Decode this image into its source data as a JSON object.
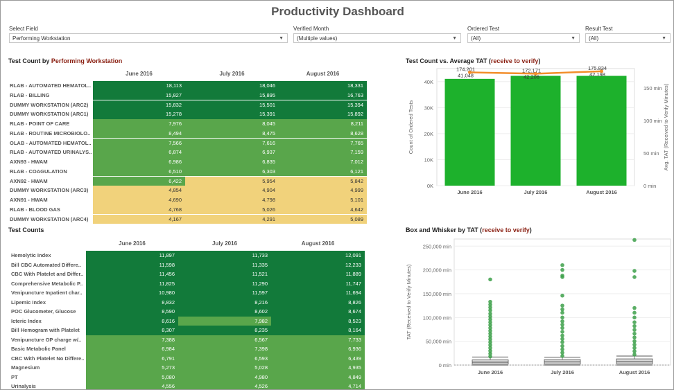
{
  "title": "Productivity Dashboard",
  "filters": [
    {
      "label": "Select Field",
      "value": "Performing Workstation"
    },
    {
      "label": "Verified Month",
      "value": "(Multiple values)"
    },
    {
      "label": "Ordered Test",
      "value": "(All)"
    },
    {
      "label": "Result Test",
      "value": "(All)"
    }
  ],
  "colors": {
    "dark_green": "#127a3a",
    "mid_green": "#59a64b",
    "light_green": "#8ecb68",
    "yellow": "#f1d27b",
    "bar_green": "#1db12c",
    "line_orange": "#f28e2b",
    "accent_red": "#8a1f11"
  },
  "table1": {
    "title_prefix": "Test Count by ",
    "title_highlight": "Performing Workstation",
    "columns": [
      "June 2016",
      "July 2016",
      "August 2016"
    ],
    "rows": [
      {
        "label": "RLAB - AUTOMATED HEMATOL..",
        "values": [
          "18,113",
          "18,046",
          "18,331"
        ],
        "shades": [
          "dark",
          "dark",
          "dark"
        ]
      },
      {
        "label": "RLAB - BILLING",
        "values": [
          "15,827",
          "15,895",
          "16,763"
        ],
        "shades": [
          "dark",
          "dark",
          "dark"
        ]
      },
      {
        "label": "DUMMY WORKSTATION (ARC2)",
        "values": [
          "15,832",
          "15,501",
          "15,394"
        ],
        "shades": [
          "dark",
          "dark",
          "dark"
        ]
      },
      {
        "label": "DUMMY WORKSTATION (ARC1)",
        "values": [
          "15,278",
          "15,391",
          "15,892"
        ],
        "shades": [
          "dark",
          "dark",
          "dark"
        ]
      },
      {
        "label": "RLAB - POINT OF CARE",
        "values": [
          "7,976",
          "8,045",
          "8,211"
        ],
        "shades": [
          "mid",
          "mid",
          "mid"
        ]
      },
      {
        "label": "RLAB - ROUTINE MICROBIOLO..",
        "values": [
          "8,494",
          "8,475",
          "8,628"
        ],
        "shades": [
          "mid",
          "mid",
          "mid"
        ]
      },
      {
        "label": "OLAB - AUTOMATED HEMATOL..",
        "values": [
          "7,566",
          "7,616",
          "7,765"
        ],
        "shades": [
          "mid",
          "mid",
          "mid"
        ]
      },
      {
        "label": "RLAB - AUTOMATED URINALYS..",
        "values": [
          "6,874",
          "6,937",
          "7,159"
        ],
        "shades": [
          "mid",
          "mid",
          "mid"
        ]
      },
      {
        "label": "AXN93 - HWAM",
        "values": [
          "6,986",
          "6,835",
          "7,012"
        ],
        "shades": [
          "mid",
          "mid",
          "mid"
        ]
      },
      {
        "label": "RLAB - COAGULATION",
        "values": [
          "6,510",
          "6,303",
          "6,121"
        ],
        "shades": [
          "mid",
          "mid",
          "mid"
        ]
      },
      {
        "label": "AXN92 - HWAM",
        "values": [
          "6,422",
          "5,954",
          "5,842"
        ],
        "shades": [
          "mid",
          "yellow",
          "yellow"
        ]
      },
      {
        "label": "DUMMY WORKSTATION (ARC3)",
        "values": [
          "4,854",
          "4,904",
          "4,999"
        ],
        "shades": [
          "yellow",
          "yellow",
          "yellow"
        ]
      },
      {
        "label": "AXN91 - HWAM",
        "values": [
          "4,690",
          "4,798",
          "5,101"
        ],
        "shades": [
          "yellow",
          "yellow",
          "yellow"
        ]
      },
      {
        "label": "RLAB - BLOOD GAS",
        "values": [
          "4,768",
          "5,026",
          "4,642"
        ],
        "shades": [
          "yellow",
          "yellow",
          "yellow"
        ]
      },
      {
        "label": "DUMMY WORKSTATION (ARC4)",
        "values": [
          "4,167",
          "4,291",
          "5,089"
        ],
        "shades": [
          "yellow",
          "yellow",
          "yellow"
        ]
      }
    ]
  },
  "table2": {
    "title": "Test Counts",
    "columns": [
      "June 2016",
      "July 2016",
      "August 2016"
    ],
    "rows": [
      {
        "label": "Hemolytic Index",
        "values": [
          "11,897",
          "11,733",
          "12,091"
        ],
        "shades": [
          "dark",
          "dark",
          "dark"
        ]
      },
      {
        "label": "Bill CBC Automated Differe..",
        "values": [
          "11,598",
          "11,335",
          "12,233"
        ],
        "shades": [
          "dark",
          "dark",
          "dark"
        ]
      },
      {
        "label": "CBC With Platelet and Differ..",
        "values": [
          "11,456",
          "11,521",
          "11,889"
        ],
        "shades": [
          "dark",
          "dark",
          "dark"
        ]
      },
      {
        "label": "Comprehensive Metabolic P..",
        "values": [
          "11,825",
          "11,290",
          "11,747"
        ],
        "shades": [
          "dark",
          "dark",
          "dark"
        ]
      },
      {
        "label": "Venipuncture Inpatient  char..",
        "values": [
          "10,980",
          "11,597",
          "11,694"
        ],
        "shades": [
          "dark",
          "dark",
          "dark"
        ]
      },
      {
        "label": "Lipemic Index",
        "values": [
          "8,832",
          "8,216",
          "8,826"
        ],
        "shades": [
          "dark",
          "dark",
          "dark"
        ]
      },
      {
        "label": "POC Glucometer, Glucose",
        "values": [
          "8,590",
          "8,602",
          "8,674"
        ],
        "shades": [
          "dark",
          "dark",
          "dark"
        ]
      },
      {
        "label": "Icteric Index",
        "values": [
          "8,616",
          "7,982",
          "8,523"
        ],
        "shades": [
          "dark",
          "mid",
          "dark"
        ]
      },
      {
        "label": "Bill Hemogram with Platelet",
        "values": [
          "8,307",
          "8,235",
          "8,164"
        ],
        "shades": [
          "dark",
          "dark",
          "dark"
        ]
      },
      {
        "label": "Venipuncture OP charge w/..",
        "values": [
          "7,388",
          "6,567",
          "7,733"
        ],
        "shades": [
          "mid",
          "mid",
          "mid"
        ]
      },
      {
        "label": "Basic Metabolic Panel",
        "values": [
          "6,984",
          "7,398",
          "6,936"
        ],
        "shades": [
          "mid",
          "mid",
          "mid"
        ]
      },
      {
        "label": "CBC With Platelet No Differe..",
        "values": [
          "6,791",
          "6,593",
          "6,439"
        ],
        "shades": [
          "mid",
          "mid",
          "mid"
        ]
      },
      {
        "label": "Magnesium",
        "values": [
          "5,273",
          "5,028",
          "4,935"
        ],
        "shades": [
          "mid",
          "mid",
          "mid"
        ]
      },
      {
        "label": "PT",
        "values": [
          "5,080",
          "4,980",
          "4,849"
        ],
        "shades": [
          "mid",
          "mid",
          "mid"
        ]
      },
      {
        "label": "Urinalysis",
        "values": [
          "4,556",
          "4,526",
          "4,714"
        ],
        "shades": [
          "mid",
          "mid",
          "mid"
        ]
      }
    ]
  },
  "chart_data": [
    {
      "type": "bar",
      "title_prefix": "Test Count vs. Average TAT (",
      "title_highlight": "receive to verify",
      "title_suffix": ")",
      "categories": [
        "June 2016",
        "July 2016",
        "August 2016"
      ],
      "series": [
        {
          "name": "Count of Ordered Tests",
          "type": "bar",
          "values": [
            41048,
            42206,
            42198
          ]
        },
        {
          "name": "Avg. TAT (Received to Verify Minutes)",
          "type": "line",
          "values": [
            174.201,
            172.171,
            175.834
          ]
        }
      ],
      "bar_labels": [
        "41,048",
        "42,206",
        "42,198"
      ],
      "line_labels": [
        "174.201",
        "172.171",
        "175.834"
      ],
      "ylabel": "Count of Ordered Tests",
      "ylabel_right": "Avg. TAT (Received to Verify Minutes)",
      "ylim": [
        0,
        45000
      ],
      "ylim_right": [
        0,
        180
      ],
      "yticks": [
        "0K",
        "10K",
        "20K",
        "30K",
        "40K"
      ],
      "yticks_right": [
        "0 min",
        "50 min",
        "100 min",
        "150 min"
      ],
      "grid": true
    },
    {
      "type": "scatter",
      "title_prefix": "Box and Whisker by TAT (",
      "title_highlight": "receive to verify",
      "title_suffix": ")",
      "categories": [
        "June 2016",
        "July 2016",
        "August 2016"
      ],
      "ylabel": "TAT (Received to Verify Minutes)",
      "ylim": [
        0,
        265000
      ],
      "yticks": [
        "0 min",
        "50,000 min",
        "100,000 min",
        "150,000 min",
        "200,000 min",
        "250,000 min"
      ],
      "outliers": [
        [
          180000,
          133000,
          127000,
          121000,
          115000,
          108000,
          102000,
          96000,
          90000,
          84000,
          78000,
          72000,
          66000,
          60000,
          54000,
          48000,
          42000,
          36000,
          30000,
          24000,
          18000
        ],
        [
          210000,
          200000,
          188000,
          185000,
          146000,
          125000,
          117000,
          110000,
          100000,
          92000,
          85000,
          78000,
          70000,
          62000,
          55000,
          48000,
          40000,
          33000,
          26000,
          19000
        ],
        [
          263000,
          198000,
          185000,
          120000,
          110000,
          100000,
          90000,
          82000,
          74000,
          66000,
          58000,
          50000,
          43000,
          36000,
          29000,
          22000
        ]
      ],
      "box": [
        {
          "q1": 2000,
          "median": 6000,
          "q3": 11000,
          "whisker_high": 17000
        },
        {
          "q1": 2000,
          "median": 6500,
          "q3": 11500,
          "whisker_high": 16500
        },
        {
          "q1": 2500,
          "median": 7000,
          "q3": 13000,
          "whisker_high": 19000
        }
      ],
      "grid": true
    }
  ]
}
